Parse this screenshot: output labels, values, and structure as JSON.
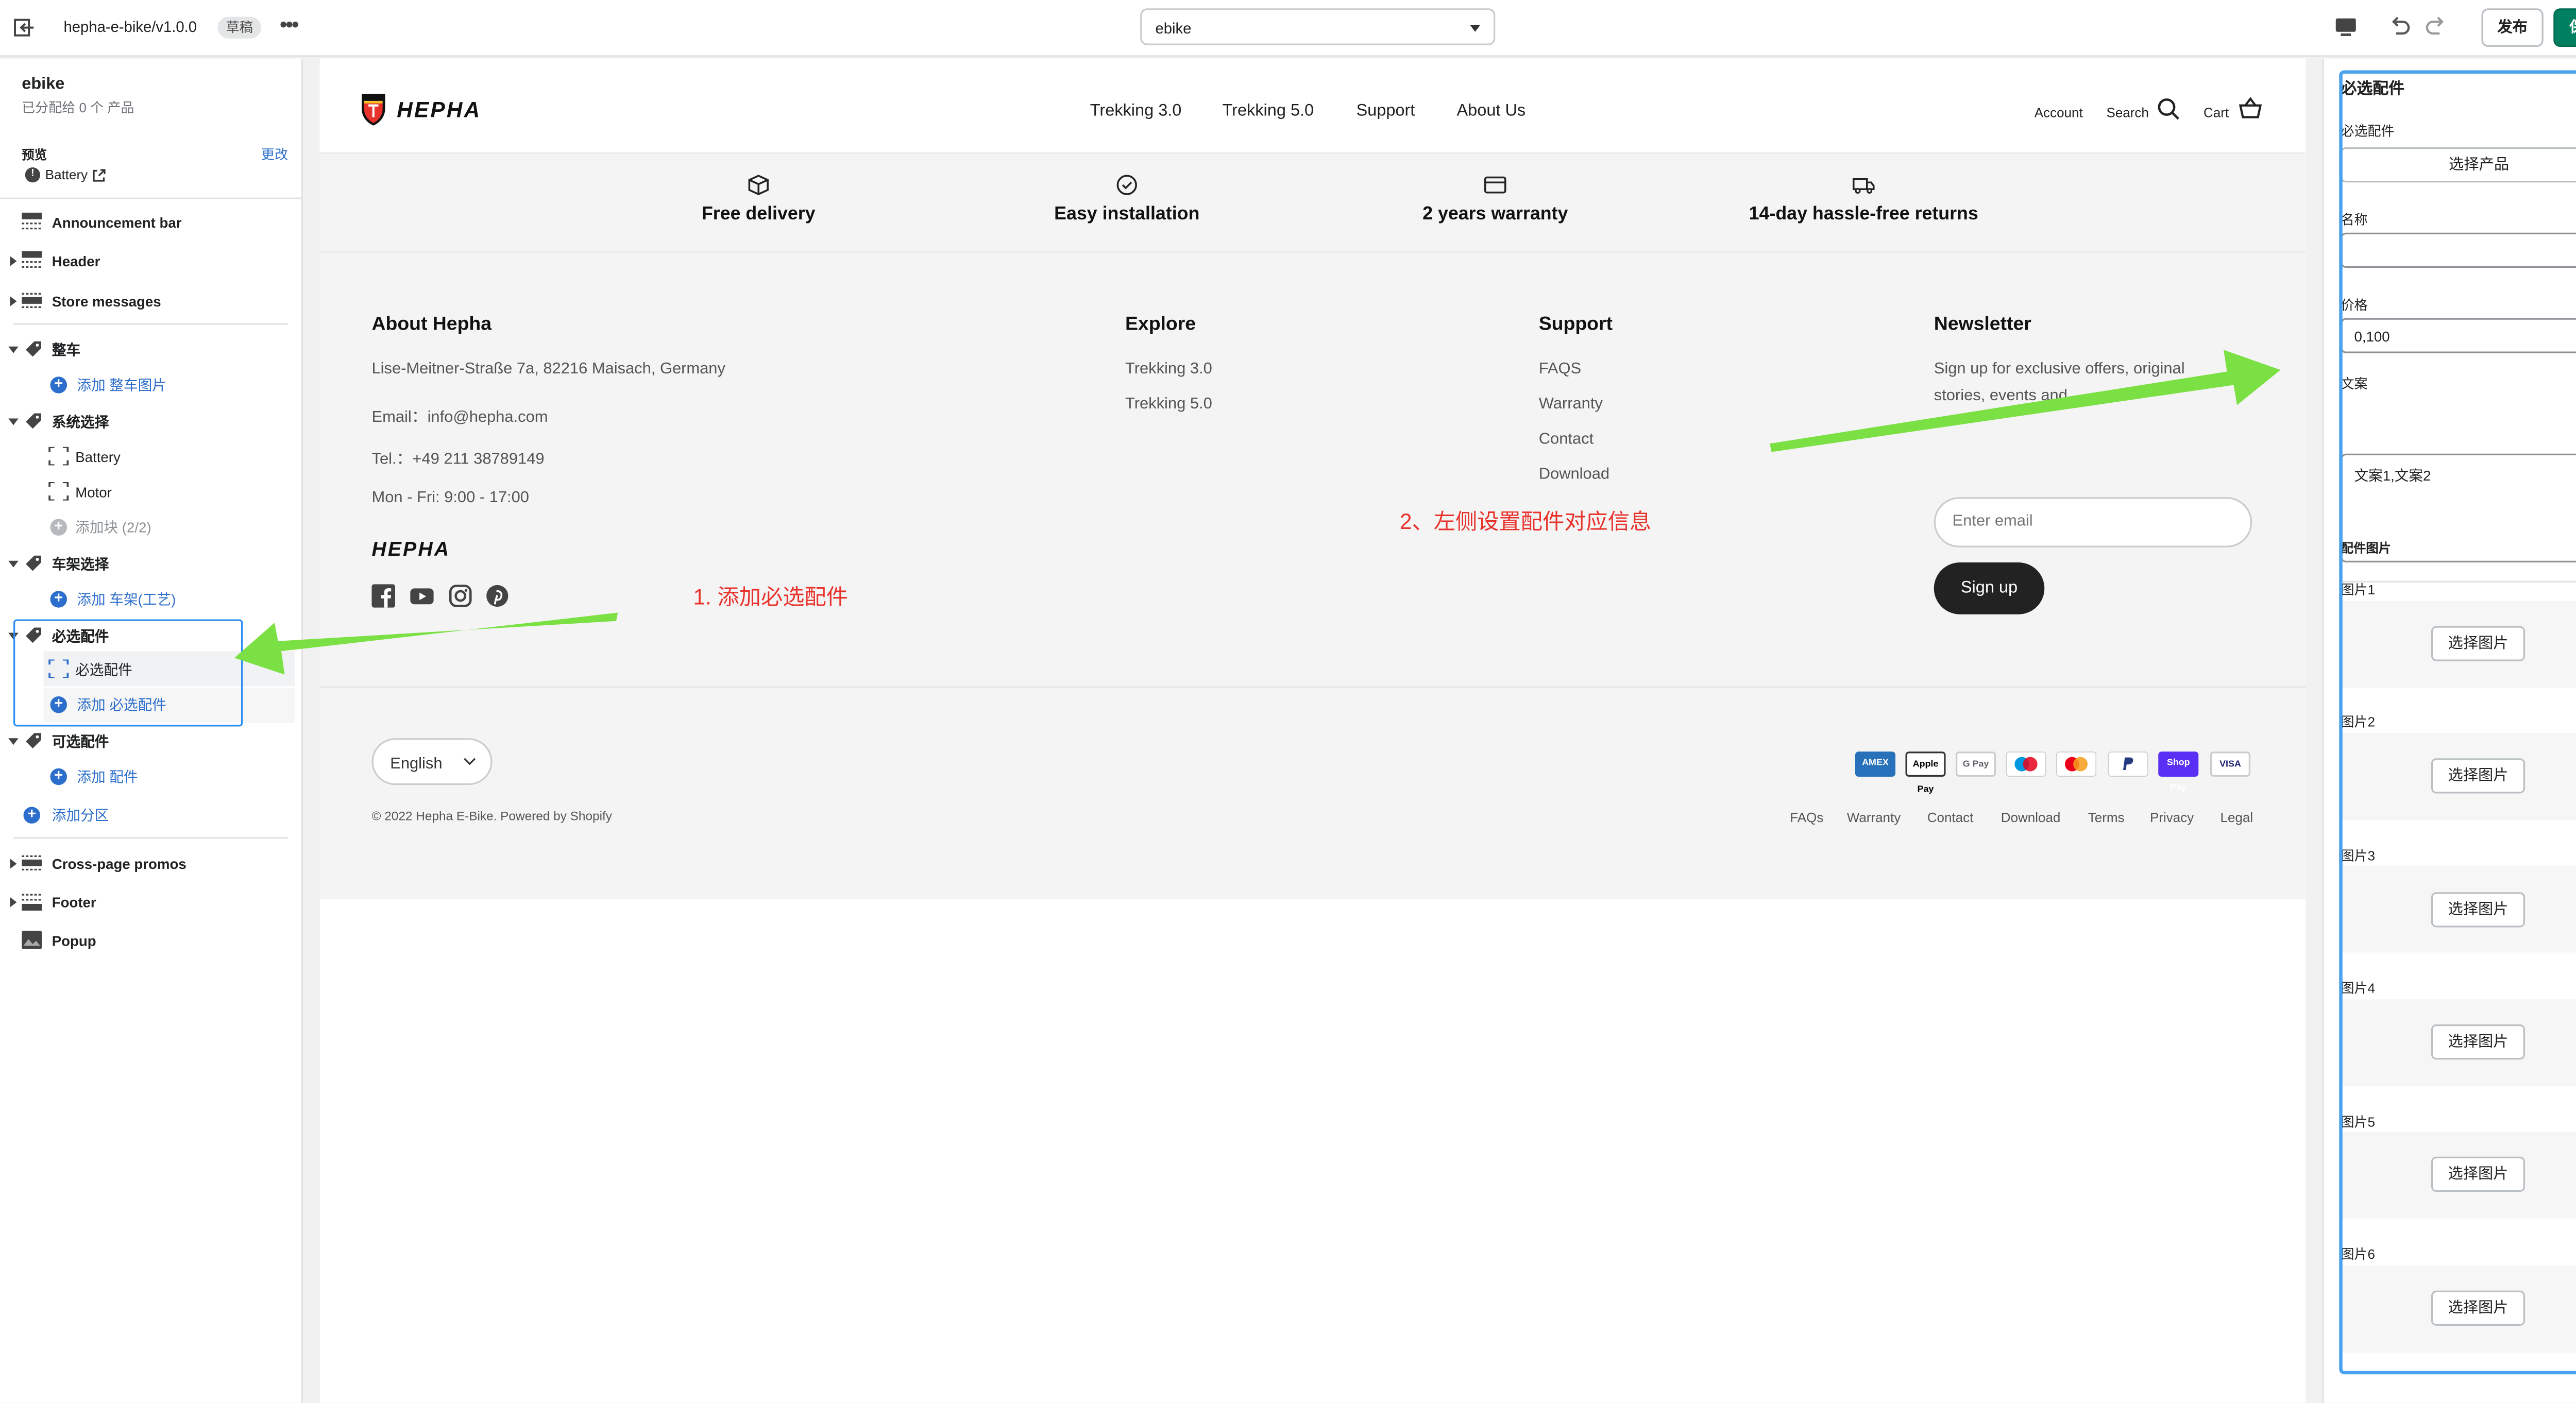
{
  "topbar": {
    "title": "hepha-e-bike/v1.0.0",
    "badge": "草稿",
    "more": "•••",
    "template_select": "ebike",
    "publish_label": "发布",
    "save_label": "保存"
  },
  "left": {
    "title": "ebike",
    "subtitle": "已分配给 0 个 产品",
    "preview_label": "预览",
    "change_label": "更改",
    "preview_value": "Battery",
    "items": [
      {
        "label": "Announcement bar"
      },
      {
        "label": "Header"
      },
      {
        "label": "Store messages"
      },
      {
        "label": "整车"
      },
      {
        "label": "添加 整车图片"
      },
      {
        "label": "系统选择"
      },
      {
        "label": "Battery"
      },
      {
        "label": "Motor"
      },
      {
        "label": "添加块 (2/2)"
      },
      {
        "label": "车架选择"
      },
      {
        "label": "添加 车架(工艺)"
      },
      {
        "label": "必选配件"
      },
      {
        "label": "必选配件"
      },
      {
        "label": "添加 必选配件"
      },
      {
        "label": "可选配件"
      },
      {
        "label": "添加 配件"
      },
      {
        "label": "添加分区"
      },
      {
        "label": "Cross-page promos"
      },
      {
        "label": "Footer"
      },
      {
        "label": "Popup"
      }
    ]
  },
  "site": {
    "logo_text": "HEPHA",
    "nav": [
      "Trekking 3.0",
      "Trekking 5.0",
      "Support",
      "About Us"
    ],
    "header_links": {
      "account": "Account",
      "search": "Search",
      "cart": "Cart"
    },
    "usps": [
      "Free delivery",
      "Easy installation",
      "2 years warranty",
      "14-day hassle-free returns"
    ],
    "footer": {
      "about_title": "About Hepha",
      "about_lines": [
        "Lise-Meitner-Straße 7a, 82216 Maisach, Germany",
        "Email：info@hepha.com",
        "Tel.：+49 211 38789149",
        "Mon - Fri: 9:00 - 17:00"
      ],
      "explore_title": "Explore",
      "explore_links": [
        "Trekking 3.0",
        "Trekking 5.0"
      ],
      "support_title": "Support",
      "support_links": [
        "FAQS",
        "Warranty",
        "Contact",
        "Download"
      ],
      "newsletter_title": "Newsletter",
      "newsletter_text_1": "Sign up for exclusive offers, original",
      "newsletter_text_2": "stories, events and",
      "email_placeholder": "Enter email",
      "signup_label": "Sign up",
      "language": "English",
      "copyright": "© 2022 Hepha E-Bike. Powered by Shopify",
      "payment_icons": [
        "AMEX",
        "Apple Pay",
        "G Pay",
        "Maestro",
        "Mastercard",
        "PayPal",
        "Shop Pay",
        "VISA"
      ],
      "bottom_links": [
        "FAQs",
        "Warranty",
        "Contact",
        "Download",
        "Terms",
        "Privacy",
        "Legal"
      ]
    }
  },
  "annotations": {
    "step1": "1. 添加必选配件",
    "step2": "2、左侧设置配件对应信息"
  },
  "right": {
    "title": "必选配件",
    "product_label": "必选配件",
    "select_product": "选择产品",
    "name_label": "名称",
    "name_value": "",
    "price_label": "价格",
    "price_value": "0,100",
    "copy_label": "文案",
    "copy_value": "文案1,文案2",
    "images_header": "配件图片",
    "images": [
      {
        "label": "图片1",
        "button": "选择图片"
      },
      {
        "label": "图片2",
        "button": "选择图片"
      },
      {
        "label": "图片3",
        "button": "选择图片"
      },
      {
        "label": "图片4",
        "button": "选择图片"
      },
      {
        "label": "图片5",
        "button": "选择图片"
      },
      {
        "label": "图片6",
        "button": "选择图片"
      }
    ]
  },
  "colors": {
    "accent_green": "#008060",
    "highlight_blue": "#2c8df3",
    "annotation_red": "#e8322c",
    "arrow_green": "#7be043"
  }
}
